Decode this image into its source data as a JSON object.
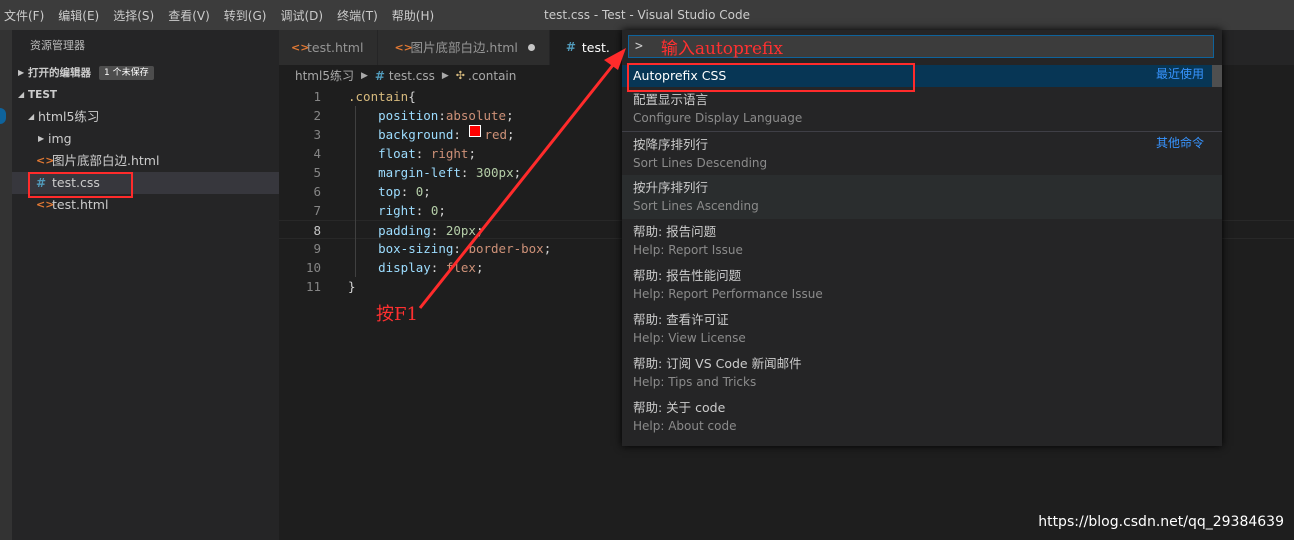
{
  "menu": [
    "文件(F)",
    "编辑(E)",
    "选择(S)",
    "查看(V)",
    "转到(G)",
    "调试(D)",
    "终端(T)",
    "帮助(H)"
  ],
  "window_title": "test.css - Test - Visual Studio Code",
  "sidebar": {
    "title": "资源管理器",
    "open_editors": {
      "label": "打开的编辑器",
      "badge": "1 个未保存"
    },
    "folder": "TEST",
    "tree": [
      {
        "label": "html5练习",
        "type": "folder"
      },
      {
        "label": "img",
        "type": "folder"
      },
      {
        "label": "图片底部白边.html",
        "type": "html"
      },
      {
        "label": "test.css",
        "type": "css"
      },
      {
        "label": "test.html",
        "type": "html"
      }
    ]
  },
  "tabs": [
    {
      "label": "test.html",
      "icon": "html-icon"
    },
    {
      "label": "图片底部白边.html",
      "icon": "html-icon",
      "dirty": true
    },
    {
      "label": "test.",
      "icon": "css-icon",
      "active": true
    }
  ],
  "breadcrumb": {
    "folder": "html5练习",
    "file": "test.css",
    "symbol": ".contain"
  },
  "code": {
    "line_numbers": [
      "1",
      "2",
      "3",
      "4",
      "5",
      "6",
      "7",
      "8",
      "9",
      "10",
      "11"
    ],
    "selector": ".contain",
    "open": "{",
    "close": "}",
    "decls": [
      {
        "prop": "position",
        "sep": ":",
        "val": "absolute"
      },
      {
        "prop": "background",
        "sep": ": ",
        "val": "red"
      },
      {
        "prop": "float",
        "sep": ": ",
        "val": "right"
      },
      {
        "prop": "margin-left",
        "sep": ": ",
        "val": "300px"
      },
      {
        "prop": "top",
        "sep": ": ",
        "val": "0"
      },
      {
        "prop": "right",
        "sep": ": ",
        "val": "0"
      },
      {
        "prop": "padding",
        "sep": ": ",
        "val": "20px"
      },
      {
        "prop": "box-sizing",
        "sep": ": ",
        "val": "border-box"
      },
      {
        "prop": "display",
        "sep": ": ",
        "val": "flex"
      }
    ]
  },
  "palette": {
    "prompt": ">",
    "annotation": "输入autoprefix",
    "items": [
      {
        "label": "Autoprefix CSS",
        "detail": "",
        "tag": "最近使用"
      },
      {
        "label": "配置显示语言",
        "detail": "Configure Display Language",
        "tag": ""
      },
      {
        "label": "按降序排列行",
        "detail": "Sort Lines Descending",
        "tag": "其他命令"
      },
      {
        "label": "按升序排列行",
        "detail": "Sort Lines Ascending",
        "tag": ""
      },
      {
        "label": "帮助: 报告问题",
        "detail": "Help: Report Issue",
        "tag": ""
      },
      {
        "label": "帮助: 报告性能问题",
        "detail": "Help: Report Performance Issue",
        "tag": ""
      },
      {
        "label": "帮助: 查看许可证",
        "detail": "Help: View License",
        "tag": ""
      },
      {
        "label": "帮助: 订阅 VS Code 新闻邮件",
        "detail": "Help: Tips and Tricks",
        "tag": ""
      },
      {
        "label": "帮助: 关于 code",
        "detail": "Help: About code",
        "tag": ""
      }
    ]
  },
  "annotation_f1": "按F1",
  "watermark": "https://blog.csdn.net/qq_29384639",
  "colors": {
    "accent": "#0e639c",
    "annotation": "#ff2b2b",
    "link": "#3794ff"
  }
}
